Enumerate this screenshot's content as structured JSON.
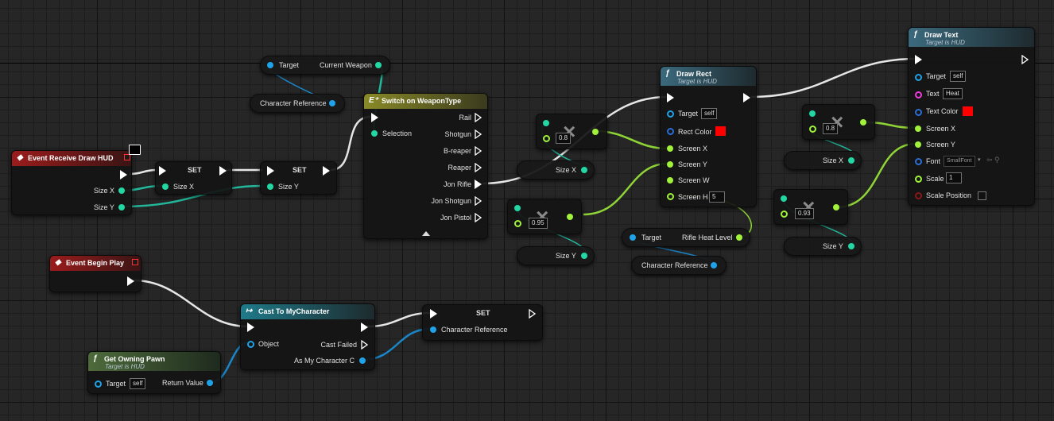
{
  "nodes": {
    "event_draw_hud": {
      "title": "Event Receive Draw HUD",
      "pins": [
        "Size X",
        "Size Y"
      ]
    },
    "set1": {
      "title": "SET",
      "pin": "Size X"
    },
    "set2": {
      "title": "SET",
      "pin": "Size Y"
    },
    "get_weapon": {
      "target": "Target",
      "output": "Current Weapon"
    },
    "char_ref_top": {
      "label": "Character Reference"
    },
    "switch": {
      "title": "Switch on WeaponType",
      "selection": "Selection",
      "outputs": [
        "Rail",
        "Shotgun",
        "B-reaper",
        "Reaper",
        "Jon Rifle",
        "Jon Shotgun",
        "Jon Pistol"
      ]
    },
    "mul1": {
      "value": "0.8"
    },
    "sizex_get1": {
      "label": "Size X"
    },
    "mul2": {
      "value": "0.95"
    },
    "sizey_get1": {
      "label": "Size Y"
    },
    "draw_rect": {
      "title": "Draw Rect",
      "subtitle": "Target is HUD",
      "pins": [
        "Target",
        "Rect Color",
        "Screen X",
        "Screen Y",
        "Screen W",
        "Screen H"
      ],
      "target_value": "self",
      "screen_h_value": "5",
      "color": "#ff0000"
    },
    "get_heat": {
      "target": "Target",
      "output": "Rifle Heat Level"
    },
    "char_ref_mid": {
      "label": "Character Reference"
    },
    "mul3": {
      "value": "0.8"
    },
    "sizex_get2": {
      "label": "Size X"
    },
    "mul4": {
      "value": "0.93"
    },
    "sizey_get2": {
      "label": "Size Y"
    },
    "draw_text": {
      "title": "Draw Text",
      "subtitle": "Target is HUD",
      "pins": [
        "Target",
        "Text",
        "Text Color",
        "Screen X",
        "Screen Y",
        "Font",
        "Scale",
        "Scale Position"
      ],
      "target_value": "self",
      "text_value": "Heat",
      "font_value": "SmallFont",
      "scale_value": "1",
      "color": "#ff0000"
    },
    "event_begin": {
      "title": "Event Begin Play"
    },
    "cast": {
      "title": "Cast To MyCharacter",
      "pins": [
        "Object",
        "Cast Failed",
        "As My Character C"
      ]
    },
    "set3": {
      "title": "SET",
      "pin": "Character Reference"
    },
    "get_pawn": {
      "title": "Get Owning Pawn",
      "subtitle": "Target is HUD",
      "target": "Target",
      "target_value": "self",
      "output": "Return Value"
    }
  },
  "colors": {
    "exec": "#ffffff",
    "float": "#a1f23a",
    "struct": "#22d7a4",
    "object": "#1fa2e8",
    "event_header": "#9b1c1c",
    "function_header": "#3b6a7d"
  },
  "icons": [
    "monitor-icon",
    "function-icon",
    "event-icon",
    "cast-icon",
    "switch-icon",
    "dropdown-icon"
  ]
}
